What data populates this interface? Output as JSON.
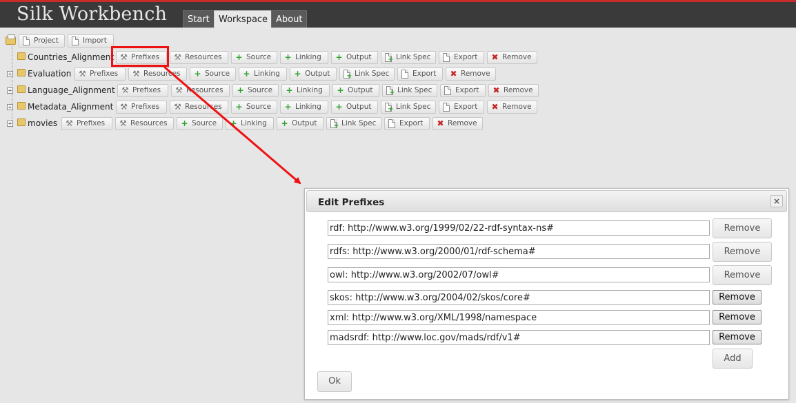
{
  "header": {
    "app_title": "Silk Workbench",
    "tabs": [
      {
        "label": "Start",
        "active": false
      },
      {
        "label": "Workspace",
        "active": true
      },
      {
        "label": "About",
        "active": false
      }
    ]
  },
  "workspace": {
    "toolbar": {
      "project_label": "Project",
      "import_label": "Import"
    },
    "actions": {
      "prefixes": "Prefixes",
      "resources": "Resources",
      "source": "Source",
      "linking": "Linking",
      "output": "Output",
      "link_spec": "Link Spec",
      "export": "Export",
      "remove": "Remove"
    },
    "projects": [
      {
        "name": "Countries_Alignment",
        "expanded": true
      },
      {
        "name": "Evaluation",
        "expanded": false
      },
      {
        "name": "Language_Alignment",
        "expanded": false
      },
      {
        "name": "Metadata_Alignment",
        "expanded": false
      },
      {
        "name": "movies",
        "expanded": false
      }
    ]
  },
  "dialog": {
    "title": "Edit Prefixes",
    "close_symbol": "×",
    "prefixes": [
      {
        "value": "rdf: http://www.w3.org/1999/02/22-rdf-syntax-ns#",
        "remove_label": "Remove"
      },
      {
        "value": "rdfs: http://www.w3.org/2000/01/rdf-schema#",
        "remove_label": "Remove"
      },
      {
        "value": "owl: http://www.w3.org/2002/07/owl#",
        "remove_label": "Remove"
      },
      {
        "value": "skos: http://www.w3.org/2004/02/skos/core#",
        "remove_label": "Remove"
      },
      {
        "value": "xml: http://www.w3.org/XML/1998/namespace",
        "remove_label": "Remove"
      },
      {
        "value": "madsrdf: http://www.loc.gov/mads/rdf/v1#",
        "remove_label": "Remove"
      }
    ],
    "add_label": "Add",
    "ok_label": "Ok"
  },
  "colors": {
    "header_bg": "#3a3a3a",
    "header_accent": "#c92a2a",
    "annotation_red": "#ee1111",
    "plus_green": "#2fa12f",
    "remove_red": "#c62828"
  }
}
